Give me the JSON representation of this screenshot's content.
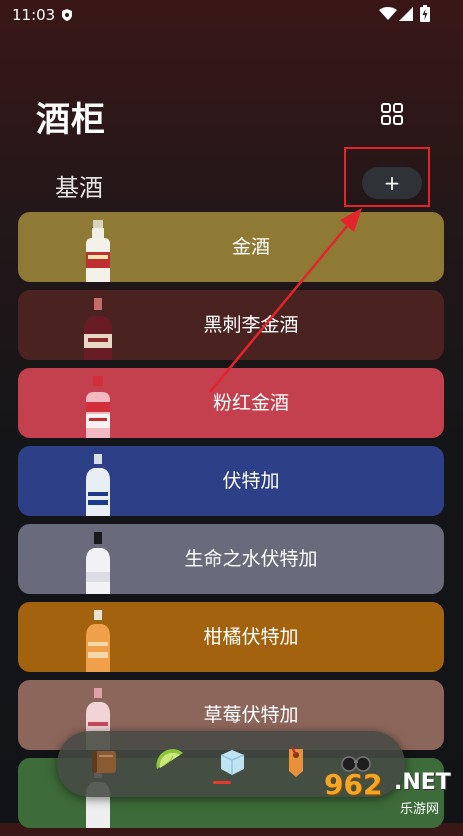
{
  "status_bar": {
    "time": "11:03"
  },
  "header": {
    "title": "酒柜"
  },
  "section": {
    "label": "基酒",
    "add_symbol": "+"
  },
  "cards": [
    {
      "label": "金酒",
      "color": "#8e7a35",
      "bottle": "gin-bottle-icon"
    },
    {
      "label": "黑刺李金酒",
      "color": "#4a2320",
      "bottle": "sloe-gin-bottle-icon"
    },
    {
      "label": "粉红金酒",
      "color": "#c4404f",
      "bottle": "pink-gin-bottle-icon"
    },
    {
      "label": "伏特加",
      "color": "#2d3f86",
      "bottle": "vodka-bottle-icon"
    },
    {
      "label": "生命之水伏特加",
      "color": "#696b7c",
      "bottle": "spirytus-bottle-icon"
    },
    {
      "label": "柑橘伏特加",
      "color": "#a3620e",
      "bottle": "citrus-vodka-bottle-icon"
    },
    {
      "label": "草莓伏特加",
      "color": "#8d665b",
      "bottle": "strawberry-vodka-bottle-icon"
    },
    {
      "label": "",
      "color": "#3e6b3a",
      "bottle": ""
    }
  ],
  "bottom_nav": [
    {
      "name": "book-icon"
    },
    {
      "name": "lime-icon",
      "active": true
    },
    {
      "name": "ice-cube-icon"
    },
    {
      "name": "tag-icon"
    },
    {
      "name": "glasses-icon"
    }
  ],
  "watermark": {
    "num": "962",
    "net": ".NET",
    "sub": "乐游网"
  },
  "colors": {
    "annotation": "#e3242b",
    "accent": "#e53b2a"
  }
}
